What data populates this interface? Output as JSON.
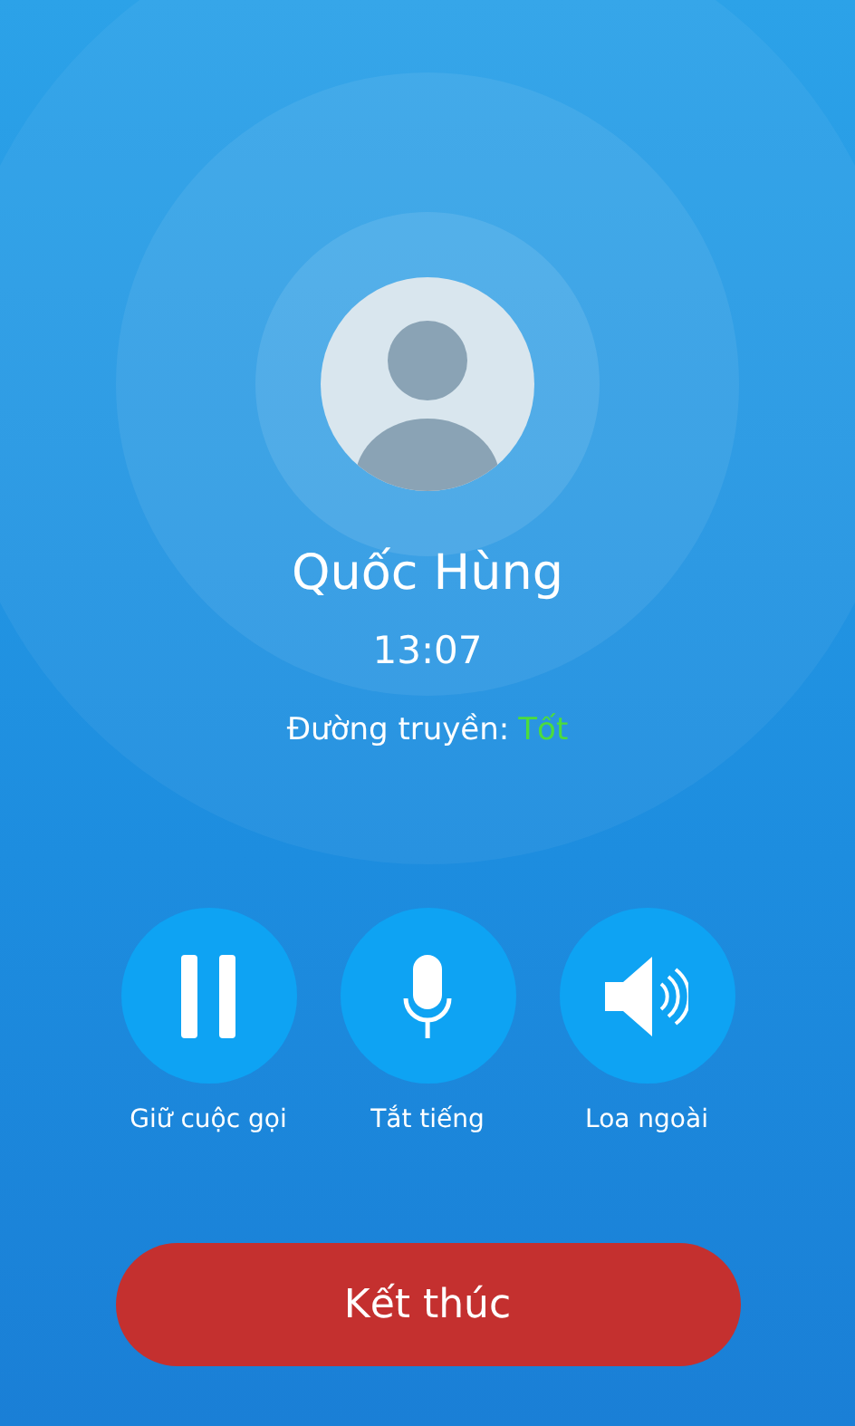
{
  "contact": {
    "name": "Quốc Hùng",
    "duration": "13:07"
  },
  "connection": {
    "label": "Đường truyền:",
    "value": "Tốt",
    "kind": "good"
  },
  "actions": [
    {
      "kind": "hold",
      "label": "Giữ cuộc gọi"
    },
    {
      "kind": "mute",
      "label": "Tắt tiếng"
    },
    {
      "kind": "speaker",
      "label": "Loa ngoài"
    }
  ],
  "end_button": {
    "label": "Kết thúc"
  }
}
